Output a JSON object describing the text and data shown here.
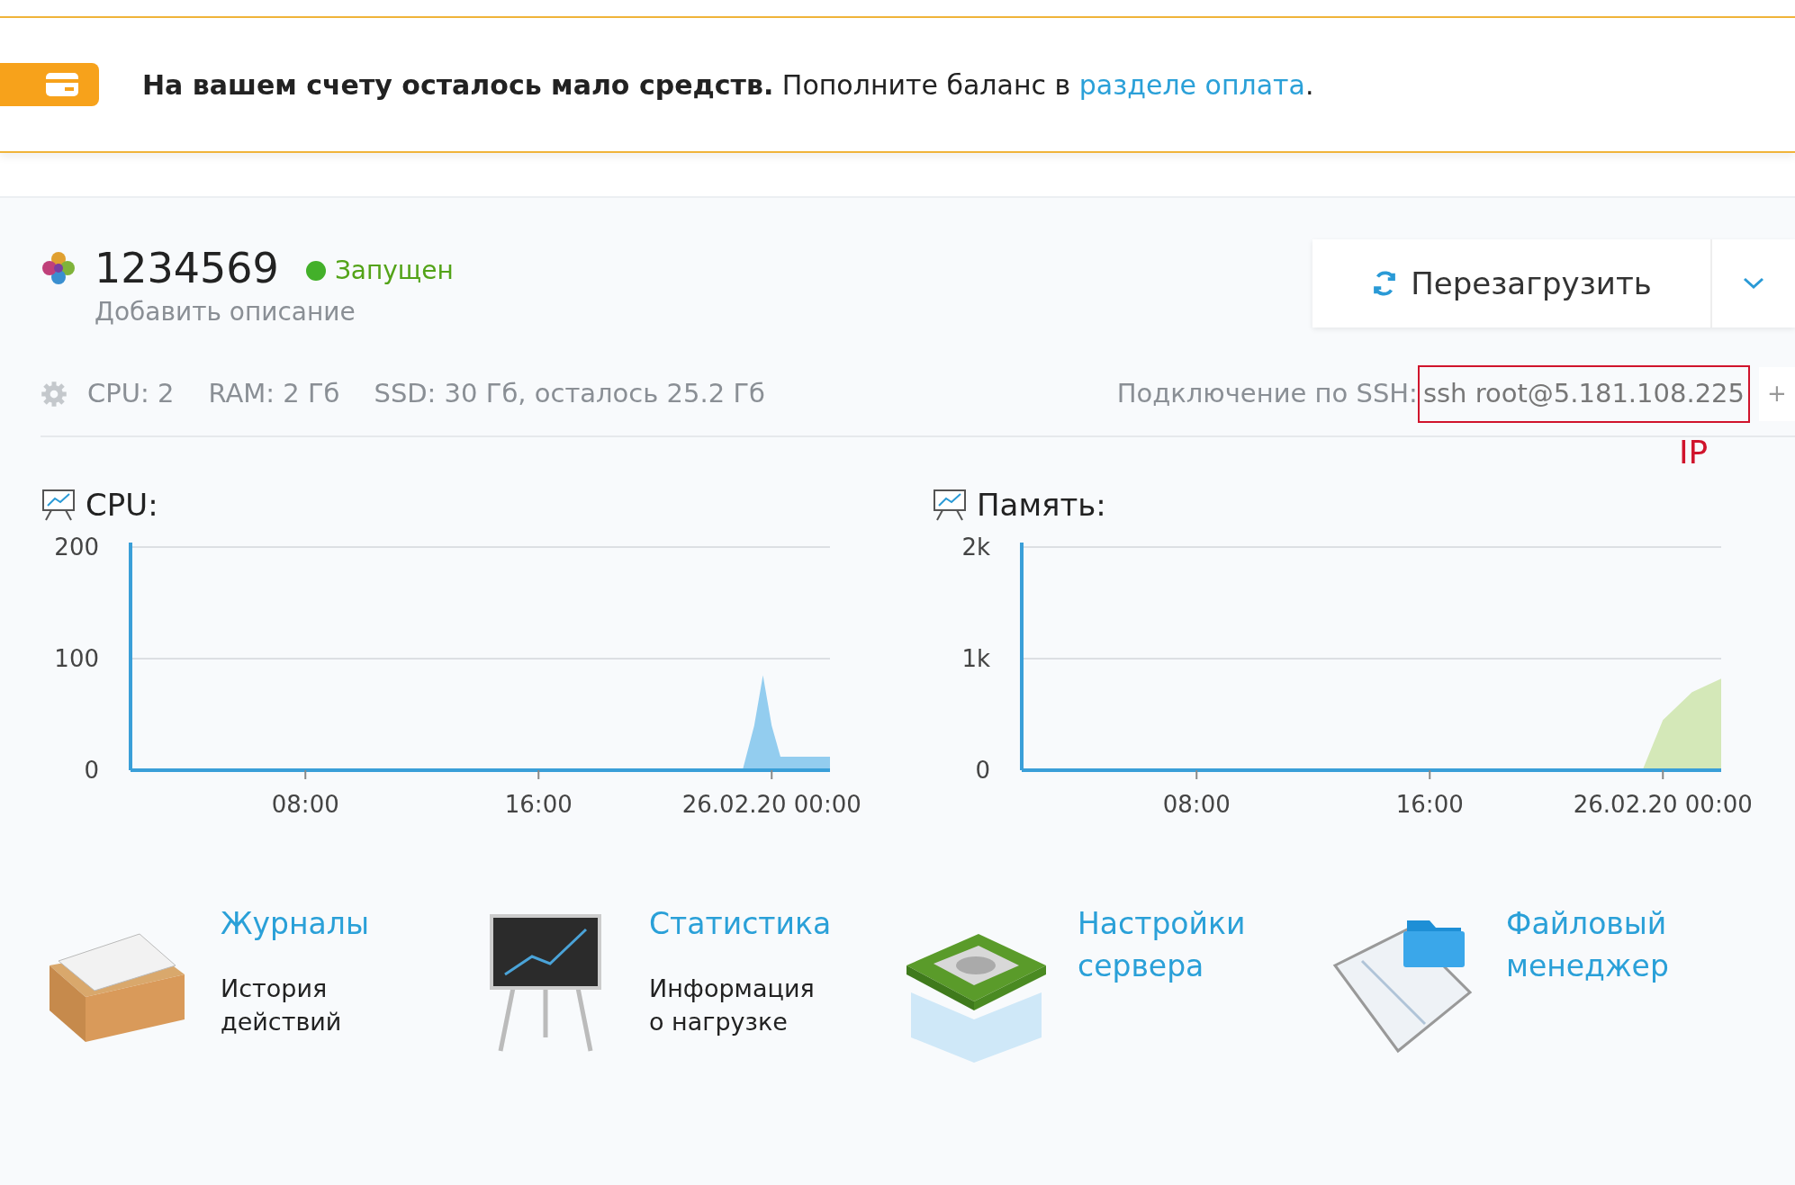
{
  "banner": {
    "text": "**На вашем счету осталось мало средств.** Пополните баланс в",
    "link": "разделе оплата",
    "end": "."
  },
  "server": {
    "id": "1234569",
    "status": {
      "label": "Запущен",
      "running": true
    },
    "description_link": "Добавить описание"
  },
  "restart_button": {
    "label": "Перезагрузить"
  },
  "specs": [
    "CPU: 2",
    "RAM: 2 Гб",
    "SSD: 30 Гб, осталось 25.2 Гб"
  ],
  "ssh": {
    "label": "Подключение по SSH:",
    "command": "ssh root@5.181.108.225",
    "annotation": "IP",
    "add_button": "+"
  },
  "charts": [
    {
      "title": "CPU:",
      "chart_data": {
        "type": "area",
        "x": [
          2,
          23,
          23.4,
          23.7,
          24,
          24.3,
          26
        ],
        "series": [
          {
            "color": "#93cdef",
            "values": [
              0,
              0,
              40,
              85,
              40,
              12,
              12
            ]
          }
        ],
        "xlim": [
          2,
          26
        ],
        "ylim": [
          0,
          200
        ],
        "yticks": [
          0,
          100,
          200
        ],
        "xticks": [
          {
            "value": 8,
            "label": "08:00"
          },
          {
            "value": 16,
            "label": "16:00"
          },
          {
            "value": 24,
            "label": "26.02.20 00:00"
          }
        ]
      }
    },
    {
      "title": "Память:",
      "chart_data": {
        "type": "area",
        "x": [
          2,
          23.3,
          24,
          25,
          26
        ],
        "series": [
          {
            "color": "#d4e8b8",
            "values": [
              0,
              0,
              450,
              700,
              820
            ]
          }
        ],
        "xlim": [
          2,
          26
        ],
        "ylim": [
          0,
          2000
        ],
        "yticks": [
          {
            "value": 0,
            "label": "0"
          },
          {
            "value": 1000,
            "label": "1k"
          },
          {
            "value": 2000,
            "label": "2k"
          }
        ],
        "xticks": [
          {
            "value": 8,
            "label": "08:00"
          },
          {
            "value": 16,
            "label": "16:00"
          },
          {
            "value": 24,
            "label": "26.02.20 00:00"
          }
        ]
      }
    }
  ],
  "tiles": [
    {
      "kind": "logs",
      "title": "Журналы",
      "subtitle": "История действий"
    },
    {
      "kind": "stats",
      "title": "Статистика",
      "subtitle": "Информация о нагрузке"
    },
    {
      "kind": "settings",
      "title": "Настройки сервера"
    },
    {
      "kind": "files",
      "title": "Файловый менеджер"
    }
  ]
}
